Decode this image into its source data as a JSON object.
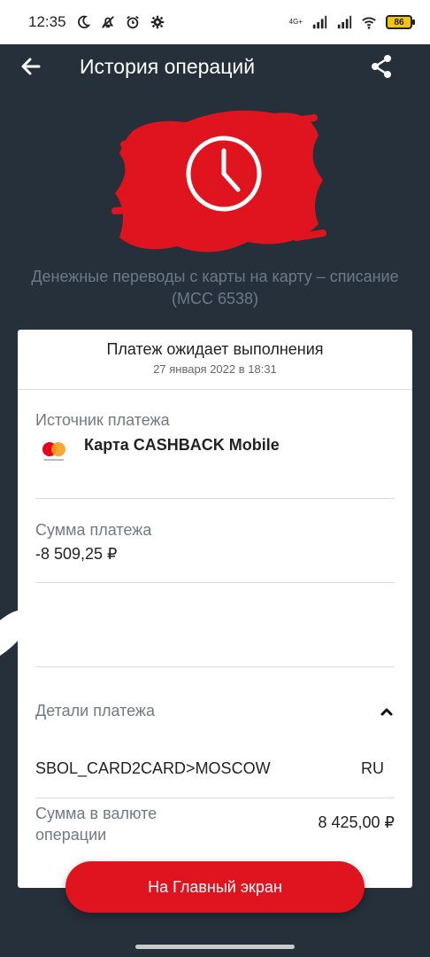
{
  "status_bar": {
    "time": "12:35",
    "network": "4G+",
    "battery": "86"
  },
  "app_bar": {
    "title": "История операций"
  },
  "hero": {
    "subtitle": "Денежные переводы с карты на карту – списание (MCC 6538)",
    "accent_color": "#e0141e"
  },
  "card": {
    "status": "Платеж ожидает выполнения",
    "date": "27 января 2022 в 18:31",
    "source": {
      "label": "Источник платежа",
      "card_name": "Карта CASHBACK Mobile"
    },
    "amount": {
      "label": "Сумма платежа",
      "value": "-8 509,25 ₽"
    },
    "details": {
      "label": "Детали платежа",
      "merchant": "SBOL_CARD2CARD>MOSCOW",
      "country": "RU",
      "currency_amount_label": "Сумма в валюте операции",
      "currency_amount_value": "8 425,00 ₽"
    }
  },
  "actions": {
    "main_screen": "На Главный экран"
  }
}
